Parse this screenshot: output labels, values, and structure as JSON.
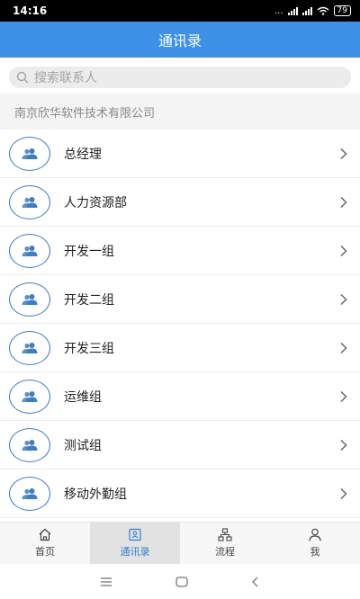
{
  "status_bar": {
    "time": "14:16",
    "network": "...",
    "battery": "79"
  },
  "header": {
    "title": "通讯录"
  },
  "search": {
    "placeholder": "搜索联系人"
  },
  "organization": {
    "name": "南京欣华软件技术有限公司"
  },
  "departments": [
    {
      "label": "总经理"
    },
    {
      "label": "人力资源部"
    },
    {
      "label": "开发一组"
    },
    {
      "label": "开发二组"
    },
    {
      "label": "开发三组"
    },
    {
      "label": "运维组"
    },
    {
      "label": "测试组"
    },
    {
      "label": "移动外勤组"
    }
  ],
  "tabs": [
    {
      "label": "首页",
      "icon": "home-icon"
    },
    {
      "label": "通讯录",
      "icon": "contacts-icon",
      "active": true
    },
    {
      "label": "流程",
      "icon": "workflow-icon"
    },
    {
      "label": "我",
      "icon": "profile-icon"
    }
  ],
  "colors": {
    "primary": "#3d91e6",
    "avatar_border": "#3d7cc6",
    "active_tab_bg": "#e2e2e2"
  }
}
